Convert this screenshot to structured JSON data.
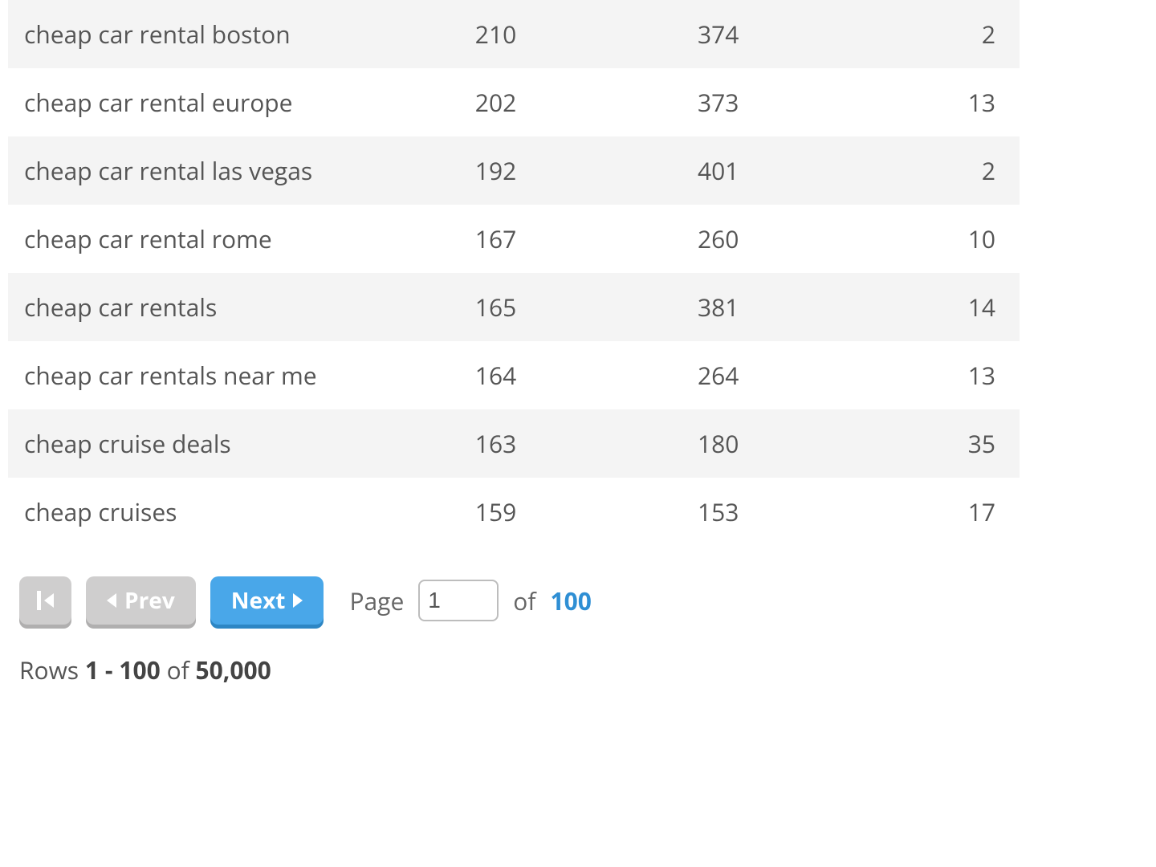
{
  "table": {
    "rows": [
      {
        "term": "cheap car rental boston",
        "col2": "210",
        "col3": "374",
        "col4": "2"
      },
      {
        "term": "cheap car rental europe",
        "col2": "202",
        "col3": "373",
        "col4": "13"
      },
      {
        "term": "cheap car rental las vegas",
        "col2": "192",
        "col3": "401",
        "col4": "2"
      },
      {
        "term": "cheap car rental rome",
        "col2": "167",
        "col3": "260",
        "col4": "10"
      },
      {
        "term": "cheap car rentals",
        "col2": "165",
        "col3": "381",
        "col4": "14"
      },
      {
        "term": "cheap car rentals near me",
        "col2": "164",
        "col3": "264",
        "col4": "13"
      },
      {
        "term": "cheap cruise deals",
        "col2": "163",
        "col3": "180",
        "col4": "35"
      },
      {
        "term": "cheap cruises",
        "col2": "159",
        "col3": "153",
        "col4": "17"
      }
    ]
  },
  "pager": {
    "prev_label": "Prev",
    "next_label": "Next",
    "page_label": "Page",
    "of_label": "of",
    "current_page": "1",
    "total_pages": "100"
  },
  "rows_summary": {
    "prefix": "Rows",
    "range": "1 - 100",
    "of": "of",
    "total": "50,000"
  }
}
